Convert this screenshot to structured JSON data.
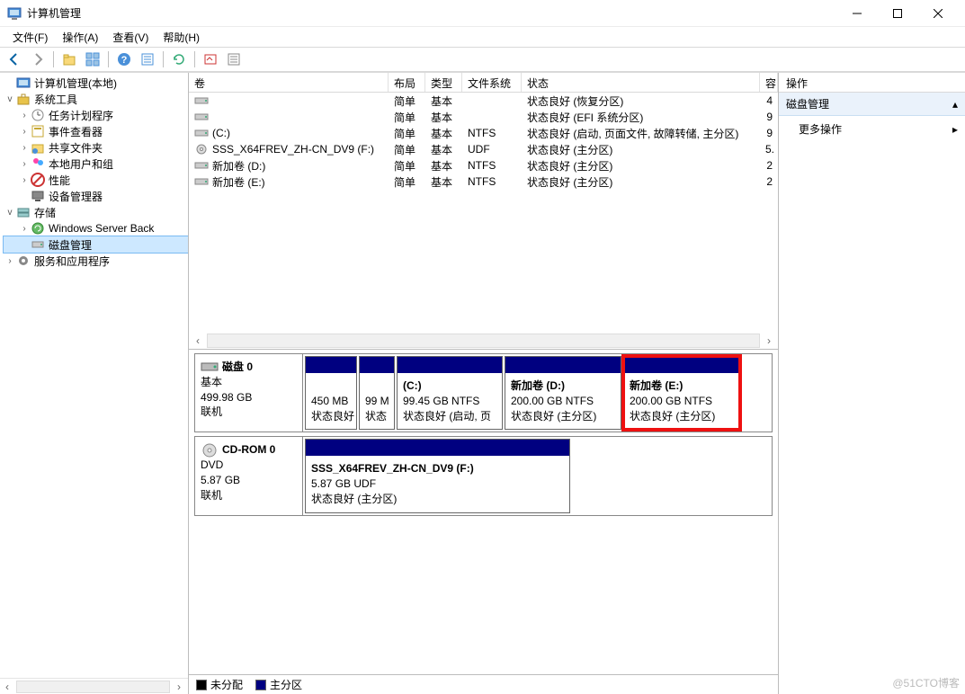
{
  "window": {
    "title": "计算机管理"
  },
  "menus": {
    "file": "文件(F)",
    "action": "操作(A)",
    "view": "查看(V)",
    "help": "帮助(H)"
  },
  "tree": {
    "root": "计算机管理(本地)",
    "system_tools": "系统工具",
    "task_scheduler": "任务计划程序",
    "event_viewer": "事件查看器",
    "shared_folders": "共享文件夹",
    "local_users": "本地用户和组",
    "performance": "性能",
    "device_manager": "设备管理器",
    "storage": "存储",
    "wsb": "Windows Server Back",
    "disk_mgmt": "磁盘管理",
    "services_apps": "服务和应用程序"
  },
  "vol_headers": {
    "volume": "卷",
    "layout": "布局",
    "type": "类型",
    "fs": "文件系统",
    "status": "状态",
    "capacity": "容"
  },
  "volumes": [
    {
      "name": "",
      "icon": "disk",
      "layout": "简单",
      "type": "基本",
      "fs": "",
      "status": "状态良好 (恢复分区)",
      "cap": "4"
    },
    {
      "name": "",
      "icon": "disk",
      "layout": "简单",
      "type": "基本",
      "fs": "",
      "status": "状态良好 (EFI 系统分区)",
      "cap": "9"
    },
    {
      "name": "(C:)",
      "icon": "disk",
      "layout": "简单",
      "type": "基本",
      "fs": "NTFS",
      "status": "状态良好 (启动, 页面文件, 故障转储, 主分区)",
      "cap": "9"
    },
    {
      "name": "SSS_X64FREV_ZH-CN_DV9 (F:)",
      "icon": "cd",
      "layout": "简单",
      "type": "基本",
      "fs": "UDF",
      "status": "状态良好 (主分区)",
      "cap": "5."
    },
    {
      "name": "新加卷 (D:)",
      "icon": "disk",
      "layout": "简单",
      "type": "基本",
      "fs": "NTFS",
      "status": "状态良好 (主分区)",
      "cap": "2"
    },
    {
      "name": "新加卷 (E:)",
      "icon": "disk",
      "layout": "简单",
      "type": "基本",
      "fs": "NTFS",
      "status": "状态良好 (主分区)",
      "cap": "2"
    }
  ],
  "disk0": {
    "title": "磁盘 0",
    "type": "基本",
    "size": "499.98 GB",
    "status": "联机",
    "parts": [
      {
        "title": "",
        "line2": "450 MB",
        "line3": "状态良好"
      },
      {
        "title": "",
        "line2": "99 M",
        "line3": "状态"
      },
      {
        "title": "(C:)",
        "line2": "99.45 GB NTFS",
        "line3": "状态良好 (启动, 页"
      },
      {
        "title": "新加卷  (D:)",
        "line2": "200.00 GB NTFS",
        "line3": "状态良好 (主分区)"
      },
      {
        "title": "新加卷  (E:)",
        "line2": "200.00 GB NTFS",
        "line3": "状态良好 (主分区)",
        "hl": true
      }
    ]
  },
  "cdrom0": {
    "title": "CD-ROM 0",
    "type": "DVD",
    "size": "5.87 GB",
    "status": "联机",
    "vol_title": "SSS_X64FREV_ZH-CN_DV9 (F:)",
    "vol_line2": "5.87 GB UDF",
    "vol_line3": "状态良好 (主分区)"
  },
  "legend": {
    "unallocated": "未分配",
    "primary": "主分区"
  },
  "actions": {
    "header": "操作",
    "section": "磁盘管理",
    "more": "更多操作"
  },
  "watermark": "@51CTO博客"
}
